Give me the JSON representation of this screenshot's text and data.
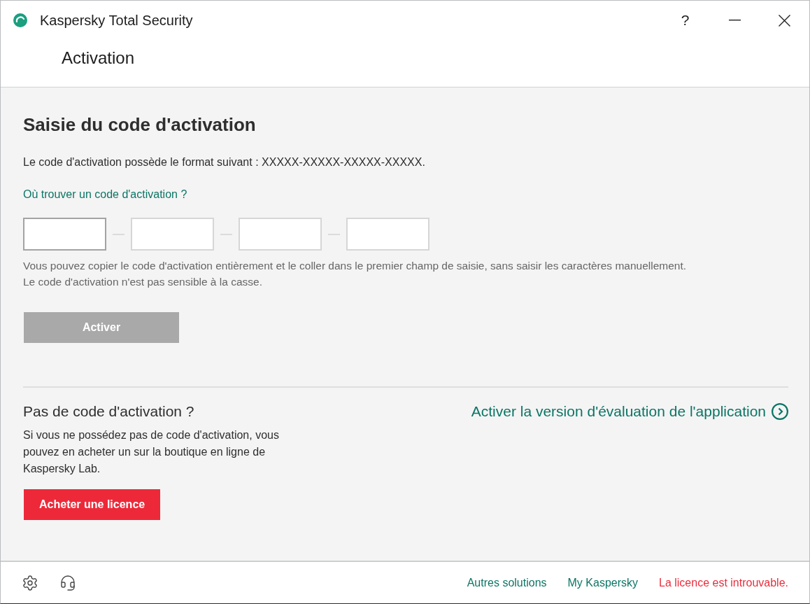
{
  "window": {
    "title": "Kaspersky Total Security",
    "help_label": "?"
  },
  "header": {
    "title": "Activation"
  },
  "activation": {
    "title": "Saisie du code d'activation",
    "format_text": "Le code d'activation possède le format suivant : XXXXX-XXXXX-XXXXX-XXXXX.",
    "help_link": "Où trouver un code d'activation ?",
    "code_fields": [
      {
        "focused": true
      },
      {
        "focused": false
      },
      {
        "focused": false
      },
      {
        "focused": false
      }
    ],
    "hint_lines": [
      "Vous pouvez copier le code d'activation entièrement et le coller dans le premier champ de saisie, sans saisir les caractères manuellement.",
      "Le code d'activation n'est pas sensible à la casse."
    ],
    "activate_button": {
      "label": "Activer",
      "disabled": true
    }
  },
  "no_code": {
    "title": "Pas de code d'activation ?",
    "text": "Si vous ne possédez pas de code d'activation, vous pouvez en acheter un sur la boutique en ligne de Kaspersky Lab.",
    "buy_button": {
      "label": "Acheter une licence"
    }
  },
  "trial_link": {
    "label": "Activer la version d'évaluation de l'application"
  },
  "footer": {
    "links": [
      {
        "label": "Autres solutions",
        "kind": "link"
      },
      {
        "label": "My Kaspersky",
        "kind": "link"
      },
      {
        "label": "La licence est introuvable.",
        "kind": "warning"
      }
    ]
  }
}
